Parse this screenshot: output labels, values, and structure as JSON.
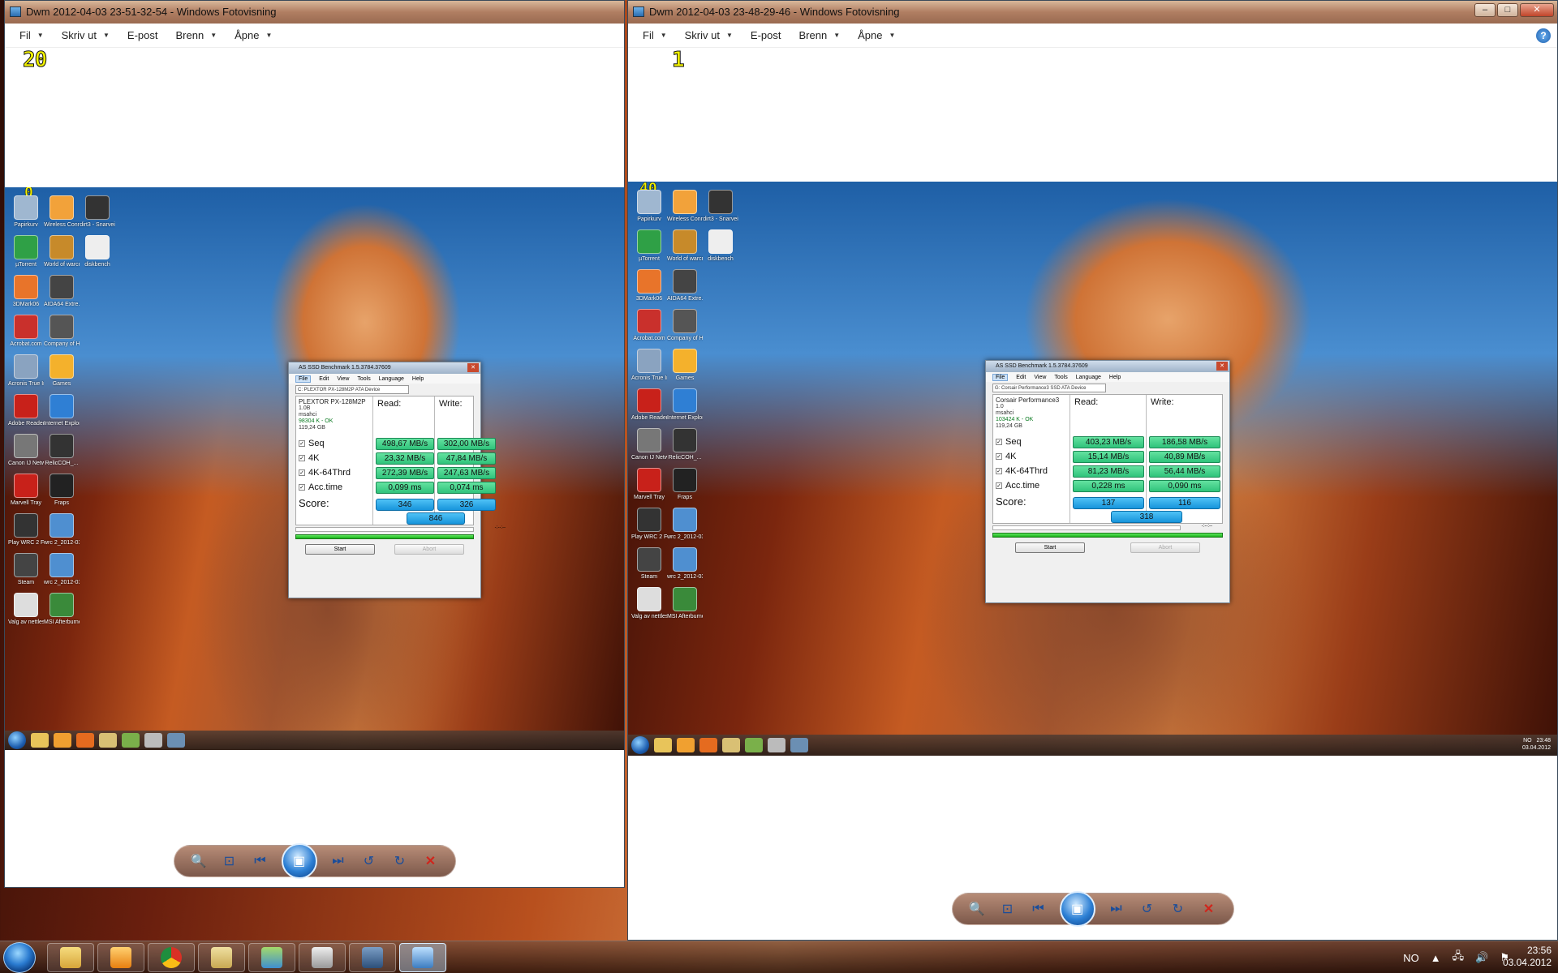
{
  "window_left": {
    "title": "Dwm 2012-04-03 23-51-32-54 - Windows Fotovisning",
    "menu": [
      {
        "label": "Fil"
      },
      {
        "label": "Skriv ut"
      },
      {
        "label": "E-post"
      },
      {
        "label": "Brenn"
      },
      {
        "label": "Åpne"
      }
    ],
    "fraps_top": "20",
    "fraps_desktop": "0",
    "desktop_icons": [
      "Papirkurv",
      "Wireless Connecti...",
      "dirt3 - Snarvei",
      "µTorrent",
      "World of warcraft",
      "diskbench",
      "3DMark06",
      "AIDA64 Extre...",
      "",
      "Acrobat.com",
      "Company of Heroes - ...",
      "",
      "Acronis True Image HD",
      "Games",
      "",
      "Adobe Reader 9",
      "Internet Explor...",
      "",
      "Canon IJ Network Tool",
      "RelicCOH_...",
      "",
      "Marvell Tray",
      "Fraps",
      "",
      "Play WRC 2 FIA World R...",
      "wrc 2_2012-03...",
      "",
      "Steam",
      "wrc 2_2012-03...",
      "",
      "Valg av nettleser",
      "MSI Afterburner",
      ""
    ],
    "benchmark": {
      "title": "AS SSD Benchmark 1.5.3784.37609",
      "menu": [
        "File",
        "Edit",
        "View",
        "Tools",
        "Language",
        "Help"
      ],
      "drive": "C: PLEXTOR PX-128M2P ATA Device",
      "info": [
        "PLEXTOR PX-128M2P",
        "1.0B",
        "msahci",
        "98304 K - OK",
        "119,24 GB"
      ],
      "read_header": "Read:",
      "write_header": "Write:",
      "rows": [
        {
          "label": "Seq",
          "read": "498,67 MB/s",
          "write": "302,00 MB/s"
        },
        {
          "label": "4K",
          "read": "23,32 MB/s",
          "write": "47,84 MB/s"
        },
        {
          "label": "4K-64Thrd",
          "read": "272,39 MB/s",
          "write": "247,63 MB/s"
        },
        {
          "label": "Acc.time",
          "read": "0,099 ms",
          "write": "0,074 ms"
        }
      ],
      "score_label": "Score:",
      "score_read": "346",
      "score_write": "326",
      "score_total": "846",
      "progress_time": "-:--:--",
      "start": "Start",
      "abort": "Abort"
    }
  },
  "window_right": {
    "title": "Dwm 2012-04-03 23-48-29-46 - Windows Fotovisning",
    "menu": [
      {
        "label": "Fil"
      },
      {
        "label": "Skriv ut"
      },
      {
        "label": "E-post"
      },
      {
        "label": "Brenn"
      },
      {
        "label": "Åpne"
      }
    ],
    "fraps_top": "1",
    "fraps_desktop": "40",
    "desktop_icons": [
      "Papirkurv",
      "Wireless Connecti...",
      "dirt3 - Snarvei",
      "µTorrent",
      "World of warcraft",
      "diskbench",
      "3DMark06",
      "AIDA64 Extre...",
      "",
      "Acrobat.com",
      "Company of Heroes - ...",
      "",
      "Acronis True Image HD",
      "Games",
      "",
      "Adobe Reader 9",
      "Internet Explor...",
      "",
      "Canon IJ Network Tool",
      "RelicCOH_...",
      "",
      "Marvell Tray",
      "Fraps",
      "",
      "Play WRC 2 FIA World R...",
      "wrc 2_2012-03...",
      "",
      "Steam",
      "wrc 2_2012-03...",
      "",
      "Valg av nettleser",
      "MSI Afterburner",
      ""
    ],
    "benchmark": {
      "title": "AS SSD Benchmark 1.5.3784.37609",
      "menu": [
        "File",
        "Edit",
        "View",
        "Tools",
        "Language",
        "Help"
      ],
      "drive": "G: Corsair Performance3 SSD ATA Device",
      "info": [
        "Corsair Performance3",
        "1.0",
        "msahci",
        "103424 K - OK",
        "119,24 GB"
      ],
      "read_header": "Read:",
      "write_header": "Write:",
      "rows": [
        {
          "label": "Seq",
          "read": "403,23 MB/s",
          "write": "186,58 MB/s"
        },
        {
          "label": "4K",
          "read": "15,14 MB/s",
          "write": "40,89 MB/s"
        },
        {
          "label": "4K-64Thrd",
          "read": "81,23 MB/s",
          "write": "56,44 MB/s"
        },
        {
          "label": "Acc.time",
          "read": "0,228 ms",
          "write": "0,090 ms"
        }
      ],
      "score_label": "Score:",
      "score_read": "137",
      "score_write": "116",
      "score_total": "318",
      "progress_time": "-:--:--",
      "start": "Start",
      "abort": "Abort"
    },
    "inner_tray": {
      "lang": "NO",
      "time": "23:48",
      "date": "03.04.2012"
    }
  },
  "taskbar": {
    "lang": "NO",
    "time": "23:56",
    "date": "03.04.2012",
    "apps": [
      "Windows Explorer",
      "Windows Media Player",
      "Chrome",
      "Windows Explorer",
      "Windows Live Messenger",
      "Disk Management",
      "Fraps",
      "Windows Photo Viewer"
    ]
  },
  "colors": {
    "green_bar": "#30c37b",
    "score_blue": "#1794db",
    "fraps_yellow": "#f3f300"
  }
}
